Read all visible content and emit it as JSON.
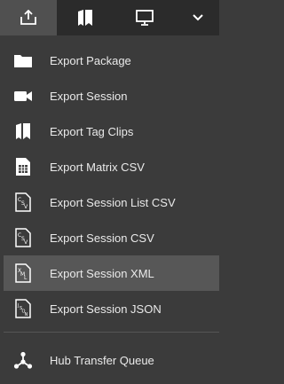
{
  "toolbar": {
    "buttons": [
      {
        "icon": "export-icon",
        "active": true
      },
      {
        "icon": "tag-clips-icon",
        "active": false
      },
      {
        "icon": "monitor-icon",
        "active": false
      },
      {
        "icon": "chevron-down-icon",
        "active": false
      }
    ]
  },
  "menu": {
    "items": [
      {
        "label": "Export Package",
        "icon": "folder-icon"
      },
      {
        "label": "Export Session",
        "icon": "video-camera-icon"
      },
      {
        "label": "Export Tag Clips",
        "icon": "tag-clips-icon"
      },
      {
        "label": "Export Matrix CSV",
        "icon": "matrix-grid-icon"
      },
      {
        "label": "Export Session List CSV",
        "icon": "csv-file-icon"
      },
      {
        "label": "Export Session CSV",
        "icon": "csv-file-icon"
      },
      {
        "label": "Export Session XML",
        "icon": "xml-file-icon",
        "highlighted": true
      },
      {
        "label": "Export Session JSON",
        "icon": "json-file-icon"
      }
    ],
    "footer_item": {
      "label": "Hub Transfer Queue",
      "icon": "hub-network-icon"
    }
  },
  "colors": {
    "toolbar_bg": "#2b2b2b",
    "menu_bg": "#3b3b3b",
    "active_bg": "#505050",
    "highlight_bg": "#575757",
    "text": "#eaeaea"
  }
}
